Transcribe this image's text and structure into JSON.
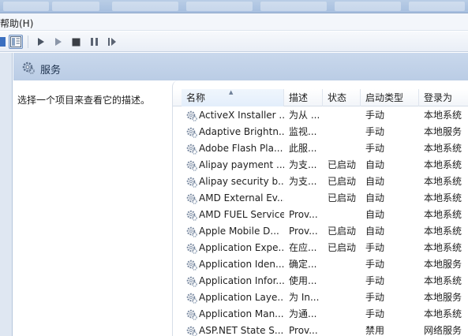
{
  "menubar": {
    "help_label": "帮助(H)"
  },
  "toolbar": {
    "buttons": [
      "show-hide-console-tree",
      "play",
      "play-alt",
      "stop",
      "pause",
      "restart"
    ]
  },
  "header": {
    "title": "服务"
  },
  "description_pane": {
    "text": "选择一个项目来查看它的描述。"
  },
  "columns": {
    "name": "名称",
    "description": "描述",
    "status": "状态",
    "startup_type": "启动类型",
    "logon_as": "登录为"
  },
  "services": [
    {
      "name": "ActiveX Installer ...",
      "description": "为从 ...",
      "status": "",
      "startup": "手动",
      "logon": "本地系统"
    },
    {
      "name": "Adaptive Brightn...",
      "description": "监视...",
      "status": "",
      "startup": "手动",
      "logon": "本地服务"
    },
    {
      "name": "Adobe Flash Pla...",
      "description": "此服...",
      "status": "",
      "startup": "手动",
      "logon": "本地系统"
    },
    {
      "name": "Alipay payment ...",
      "description": "为支...",
      "status": "已启动",
      "startup": "自动",
      "logon": "本地系统"
    },
    {
      "name": "Alipay security b...",
      "description": "为支...",
      "status": "已启动",
      "startup": "自动",
      "logon": "本地系统"
    },
    {
      "name": "AMD External Ev...",
      "description": "",
      "status": "已启动",
      "startup": "自动",
      "logon": "本地系统"
    },
    {
      "name": "AMD FUEL Service",
      "description": "Prov...",
      "status": "",
      "startup": "自动",
      "logon": "本地系统"
    },
    {
      "name": "Apple Mobile D...",
      "description": "Prov...",
      "status": "已启动",
      "startup": "自动",
      "logon": "本地系统"
    },
    {
      "name": "Application Expe...",
      "description": "在应...",
      "status": "已启动",
      "startup": "手动",
      "logon": "本地系统"
    },
    {
      "name": "Application Iden...",
      "description": "确定...",
      "status": "",
      "startup": "手动",
      "logon": "本地服务"
    },
    {
      "name": "Application Infor...",
      "description": "使用...",
      "status": "",
      "startup": "手动",
      "logon": "本地系统"
    },
    {
      "name": "Application Laye...",
      "description": "为 In...",
      "status": "",
      "startup": "手动",
      "logon": "本地服务"
    },
    {
      "name": "Application Man...",
      "description": "为通...",
      "status": "",
      "startup": "手动",
      "logon": "本地系统"
    },
    {
      "name": "ASP.NET State S...",
      "description": "Prov...",
      "status": "",
      "startup": "禁用",
      "logon": "网络服务"
    }
  ]
}
